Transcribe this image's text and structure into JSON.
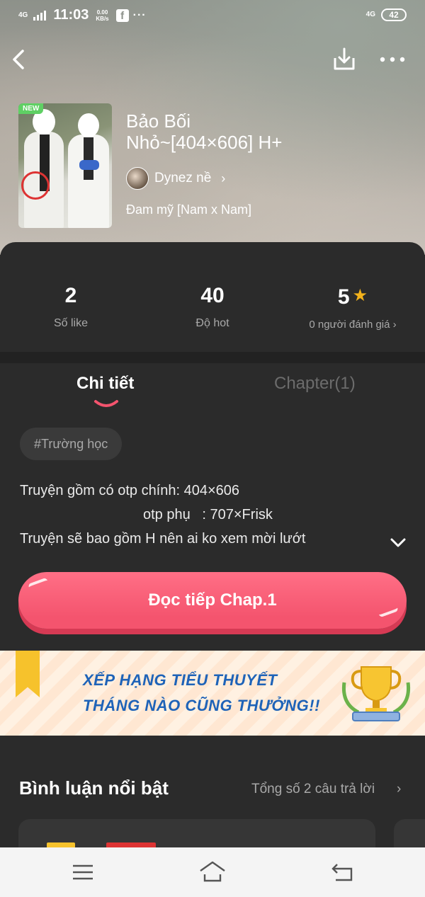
{
  "status_bar": {
    "network_left": "4G",
    "time": "11:03",
    "speed_value": "0.00",
    "speed_unit": "KB/s",
    "fb_glyph": "f",
    "more_glyph": "···",
    "network_right": "4G",
    "battery": "42"
  },
  "icons": {
    "back": "back-icon",
    "download": "download-icon",
    "more": "more-icon",
    "star": "star-icon",
    "expand": "chevron-down-icon",
    "menu": "menu-icon",
    "home": "home-icon",
    "nav_back": "back-nav-icon"
  },
  "novel": {
    "badge": "NEW",
    "title_line1": "Bảo Bối",
    "title_line2": "Nhỏ~[404×606] H+",
    "author": "Dynez nề",
    "author_chevron": "›",
    "genre": "Đam mỹ [Nam x Nam]"
  },
  "stats": {
    "likes_value": "2",
    "likes_label": "Số like",
    "hot_value": "40",
    "hot_label": "Độ hot",
    "rating_value": "5",
    "rating_label": "0 người đánh giá",
    "rating_chevron": "›"
  },
  "tabs": {
    "detail": "Chi tiết",
    "chapter": "Chapter(1)"
  },
  "tag": "#Trường học",
  "description": {
    "line1": "Truyện gồm có otp chính: 404×606",
    "line2": "otp phụ   : 707×Frisk",
    "line3": "Truyện sẽ bao gồm H nên ai ko xem mời lướt"
  },
  "read_button": "Đọc tiếp Chap.1",
  "banner": {
    "line1": "XẾP HẠNG TIỂU THUYẾT",
    "line2": "THÁNG NÀO CŨNG THƯỞNG!!"
  },
  "comments": {
    "title": "Bình luận nổi bật",
    "count": "Tổng số 2 câu trả lời",
    "chevron": "›"
  },
  "colors": {
    "accent": "#f4546e",
    "panel": "#2b2b2b",
    "star": "#f3b21b",
    "banner_text": "#1e63b8",
    "new_badge": "#5fd064"
  }
}
